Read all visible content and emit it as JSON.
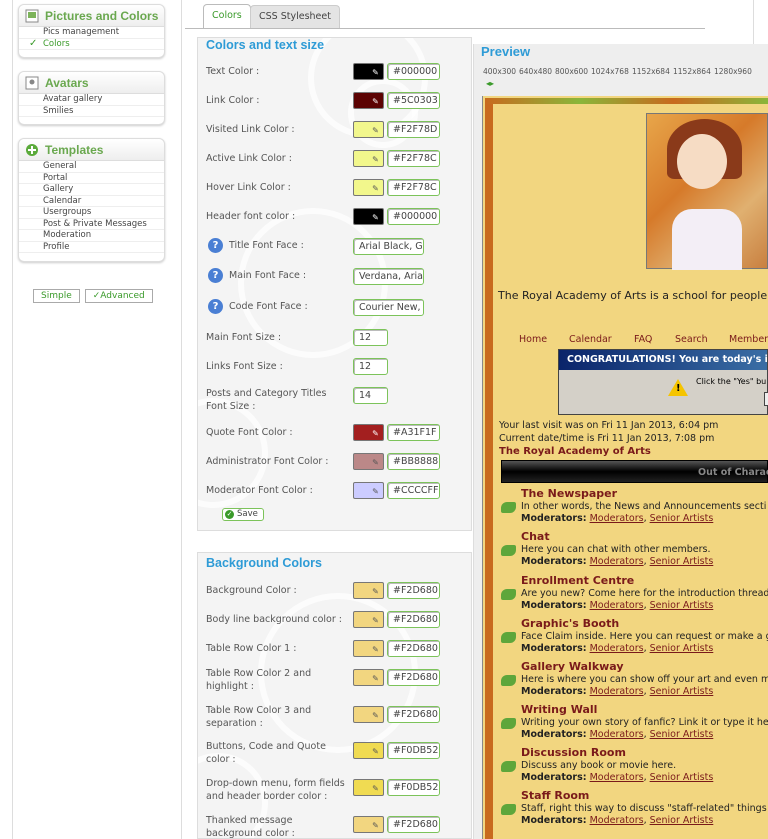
{
  "sidebar": {
    "pictures": {
      "title": "Pictures and Colors",
      "items": [
        {
          "label": "Pics management"
        },
        {
          "label": "Colors"
        }
      ]
    },
    "avatars": {
      "title": "Avatars",
      "items": [
        {
          "label": "Avatar gallery"
        },
        {
          "label": "Smilies"
        }
      ]
    },
    "templates": {
      "title": "Templates",
      "items": [
        {
          "label": "General"
        },
        {
          "label": "Portal"
        },
        {
          "label": "Gallery"
        },
        {
          "label": "Calendar"
        },
        {
          "label": "Usergroups"
        },
        {
          "label": "Post & Private Messages"
        },
        {
          "label": "Moderation"
        },
        {
          "label": "Profile"
        }
      ]
    },
    "view": {
      "simple": "Simple",
      "advanced": "Advanced"
    }
  },
  "tabs": [
    {
      "label": "Colors"
    },
    {
      "label": "CSS Stylesheet"
    }
  ],
  "colors_section": {
    "title": "Colors and text size",
    "rows": [
      {
        "label": "Text Color   :",
        "value": "#000000",
        "color": "#000000"
      },
      {
        "label": "Link Color   :",
        "value": "#5C0303",
        "color": "#5C0303"
      },
      {
        "label": "Visited Link Color   :",
        "value": "#F2F78D",
        "color": "#F2F78D"
      },
      {
        "label": "Active Link Color   :",
        "value": "#F2F78C",
        "color": "#F2F78C"
      },
      {
        "label": "Hover Link Color   :",
        "value": "#F2F78C",
        "color": "#F2F78C"
      },
      {
        "label": "Header font color   :",
        "value": "#000000",
        "color": "#000000"
      }
    ],
    "fonts": [
      {
        "label": "Title Font Face   :",
        "value": "Arial Black, G"
      },
      {
        "label": "Main Font Face   :",
        "value": "Verdana, Aria"
      },
      {
        "label": "Code Font Face   :",
        "value": "Courier New,"
      }
    ],
    "sizes": [
      {
        "label": "Main Font Size   :",
        "value": "12"
      },
      {
        "label": "Links Font Size   :",
        "value": "12"
      },
      {
        "label": "Posts and Category Titles Font Size   :",
        "value": "14"
      }
    ],
    "rows2": [
      {
        "label": "Quote Font Color   :",
        "value": "#A31F1F",
        "color": "#A31F1F"
      },
      {
        "label": "Administrator Font Color   :",
        "value": "#BB8888",
        "color": "#BB8888"
      },
      {
        "label": "Moderator Font Color   :",
        "value": "#CCCCFF",
        "color": "#CCCCFF"
      }
    ],
    "save": "Save"
  },
  "background_section": {
    "title": "Background Colors",
    "rows": [
      {
        "label": "Background Color   :",
        "value": "#F2D680",
        "color": "#F2D680"
      },
      {
        "label": "Body line background color   :",
        "value": "#F2D680",
        "color": "#F2D680"
      },
      {
        "label": "Table Row Color 1   :",
        "value": "#F2D680",
        "color": "#F2D680"
      },
      {
        "label": "Table Row Color 2 and highlight   :",
        "value": "#F2D680",
        "color": "#F2D680"
      },
      {
        "label": "Table Row Color 3 and separation   :",
        "value": "#F2D680",
        "color": "#F2D680"
      },
      {
        "label": "Buttons, Code and Quote color   :",
        "value": "#F0DB52",
        "color": "#F0DB52"
      },
      {
        "label": "Drop-down menu, form fields and header border color   :",
        "value": "#F0DB52",
        "color": "#F0DB52"
      },
      {
        "label": "Thanked message background color   :",
        "value": "#F2D680",
        "color": "#F2D680"
      }
    ]
  },
  "preview": {
    "title": "Preview",
    "resolutions": [
      "400x300",
      "640x480",
      "800x600",
      "1024x768",
      "1152x684",
      "1152x864",
      "1280x960"
    ],
    "description": "The Royal Academy of Arts is a school for people",
    "nav": [
      "Home",
      "Calendar",
      "FAQ",
      "Search",
      "Member"
    ],
    "dialog_title": "CONGRATULATIONS! You are today's iPho",
    "dialog_text": "Click the \"Yes\" bu",
    "last_visit": "Your last visit was on Fri 11 Jan 2013, 6:04 pm",
    "current": "Current date/time is Fri 11 Jan 2013, 7:08 pm",
    "site_name": "The Royal Academy of Arts",
    "category": "Out of Characte",
    "mod_label": "Moderators:",
    "mod_links": [
      "Moderators",
      "Senior Artists"
    ],
    "forums": [
      {
        "name": "The Newspaper",
        "desc": "In other words, the News and Announcements secti"
      },
      {
        "name": "Chat",
        "desc": "Here you can chat with other members."
      },
      {
        "name": "Enrollment Centre",
        "desc": "Are you new? Come here for the introduction thread"
      },
      {
        "name": "Graphic's Booth",
        "desc": "Face Claim inside. Here you can request or make a g"
      },
      {
        "name": "Gallery Walkway",
        "desc": "Here is where you can show off your art and even m"
      },
      {
        "name": "Writing Wall",
        "desc": "Writing your own story of fanfic? Link it or type it he"
      },
      {
        "name": "Discussion Room",
        "desc": "Discuss any book or movie here."
      },
      {
        "name": "Staff Room",
        "desc": "Staff, right this way to discuss \"staff-related\" things"
      }
    ]
  }
}
